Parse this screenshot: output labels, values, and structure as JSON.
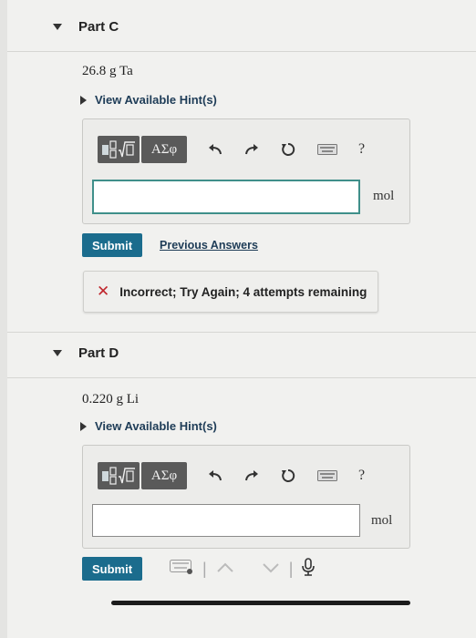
{
  "partC": {
    "title": "Part C",
    "question": "26.8 g Ta",
    "hint_label": "View Available Hint(s)",
    "toolbar": {
      "symbols_label": "ΑΣφ",
      "help_label": "?"
    },
    "unit": "mol",
    "answer_value": "",
    "submit_label": "Submit",
    "previous_answers_label": "Previous Answers",
    "feedback": "Incorrect; Try Again; 4 attempts remaining",
    "feedback_mark": "✕"
  },
  "partD": {
    "title": "Part D",
    "question": "0.220 g Li",
    "hint_label": "View Available Hint(s)",
    "toolbar": {
      "symbols_label": "ΑΣφ",
      "help_label": "?"
    },
    "unit": "mol",
    "answer_value": "",
    "submit_label": "Submit"
  },
  "colors": {
    "accent": "#1b6c8d",
    "error": "#c0262d",
    "focus": "#3f8f8a",
    "link": "#1e3c57"
  },
  "icons": [
    "templates-icon",
    "undo-icon",
    "redo-icon",
    "reset-icon",
    "keyboard-icon",
    "help-icon",
    "close-icon",
    "microphone-icon"
  ]
}
